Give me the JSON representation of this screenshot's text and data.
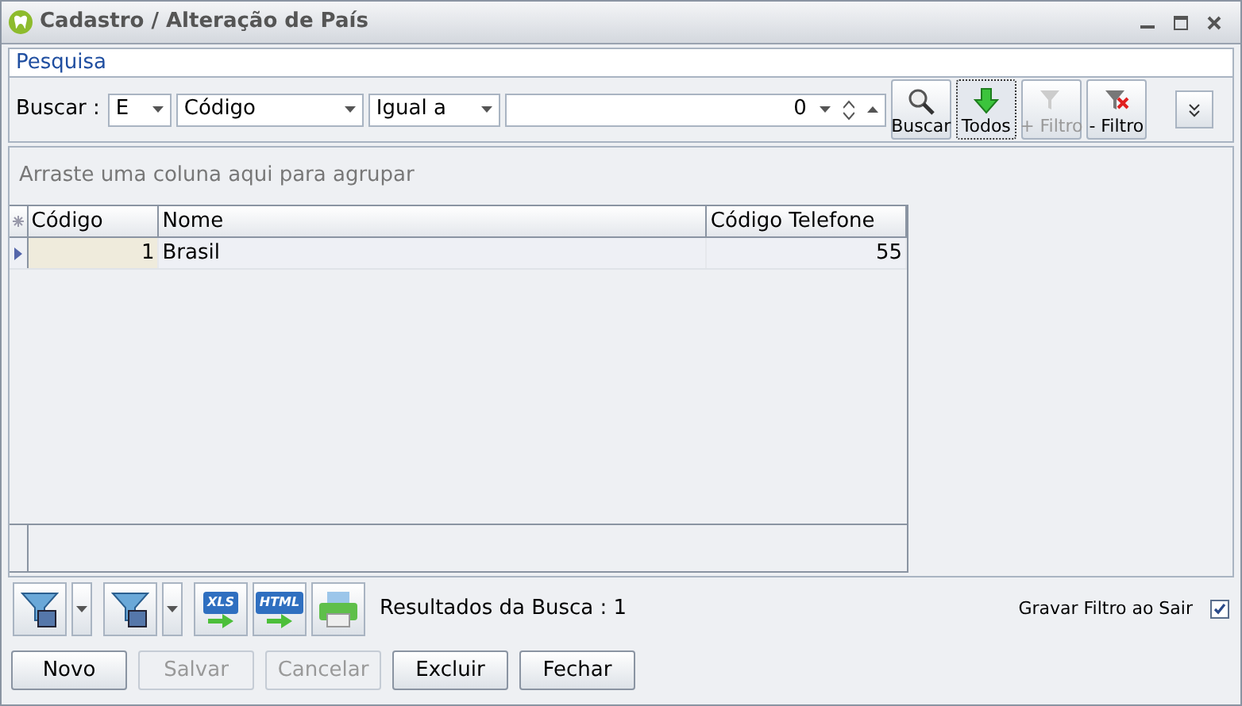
{
  "window": {
    "title": "Cadastro / Alteração de País"
  },
  "search_panel": {
    "title": "Pesquisa",
    "label": "Buscar :",
    "connector": "E",
    "field": "Código",
    "operator": "Igual a",
    "value": "0",
    "buttons": [
      {
        "label": "Buscar",
        "kind": "search",
        "disabled": false,
        "selected": false
      },
      {
        "label": "Todos",
        "kind": "all",
        "disabled": false,
        "selected": true
      },
      {
        "label": "+ Filtro",
        "kind": "add",
        "disabled": true,
        "selected": false
      },
      {
        "label": "- Filtro",
        "kind": "remove",
        "disabled": false,
        "selected": false
      }
    ]
  },
  "group_hint": "Arraste uma coluna aqui para agrupar",
  "table": {
    "columns": [
      "Código",
      "Nome",
      "Código Telefone"
    ],
    "rows": [
      {
        "cells": [
          "1",
          "Brasil",
          "55"
        ],
        "selected": true
      }
    ]
  },
  "footer": {
    "export_labels": [
      "XLS",
      "HTML"
    ],
    "results": "Resultados da Busca : 1",
    "save_filter": {
      "label": "Gravar Filtro ao Sair",
      "checked": true
    }
  },
  "buttons": [
    {
      "label": "Novo",
      "disabled": false
    },
    {
      "label": "Salvar",
      "disabled": true
    },
    {
      "label": "Cancelar",
      "disabled": true
    },
    {
      "label": "Excluir",
      "disabled": false
    },
    {
      "label": "Fechar",
      "disabled": false
    }
  ]
}
